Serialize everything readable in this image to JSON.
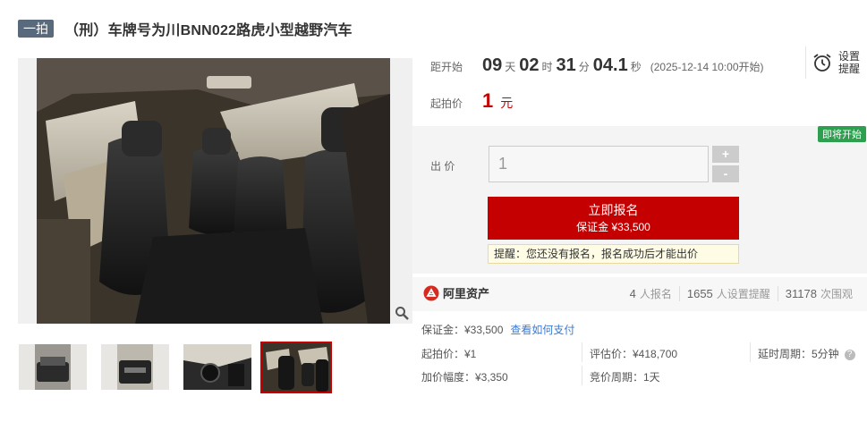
{
  "header": {
    "badge": "一拍",
    "title": "（刑）车牌号为川BNN022路虎小型越野汽车"
  },
  "countdown": {
    "label": "距开始",
    "days": "09",
    "days_unit": "天",
    "hours": "02",
    "hours_unit": "时",
    "minutes": "31",
    "minutes_unit": "分",
    "seconds": "04.1",
    "seconds_unit": "秒",
    "start_time": "(2025-12-14 10:00开始)"
  },
  "reminder": {
    "line1": "设置",
    "line2": "提醒",
    "icon": "alarm-clock-icon"
  },
  "start_price": {
    "label": "起拍价",
    "value": "1",
    "unit": "元"
  },
  "bid": {
    "status_badge": "即将开始",
    "label": "出 价",
    "input_value": "1",
    "plus": "+",
    "minus": "-",
    "register_label": "立即报名",
    "deposit_label": "保证金 ¥33,500",
    "tip": "提醒：您还没有报名，报名成功后才能出价"
  },
  "stats": {
    "brand": "阿里资产",
    "registered_num": "4",
    "registered_txt": "人报名",
    "reminders_num": "1655",
    "reminders_txt": "人设置提醒",
    "views_num": "31178",
    "views_txt": "次围观"
  },
  "details": {
    "deposit": "保证金：¥33,500",
    "how_to_pay": "查看如何支付",
    "start_price": "起拍价：¥1",
    "appraisal": "评估价：¥418,700",
    "delay": "延时周期：5分钟",
    "increment": "加价幅度：¥3,350",
    "bid_period": "竞价周期：1天"
  },
  "icons": {
    "zoom": "magnifier-icon",
    "help": "question-icon",
    "brand_logo": "ali-asset-logo"
  },
  "colors": {
    "accent": "#c40000",
    "badge_bg": "#5a6a7d",
    "status_green": "#2e9e4f",
    "link": "#3a7bd5"
  }
}
